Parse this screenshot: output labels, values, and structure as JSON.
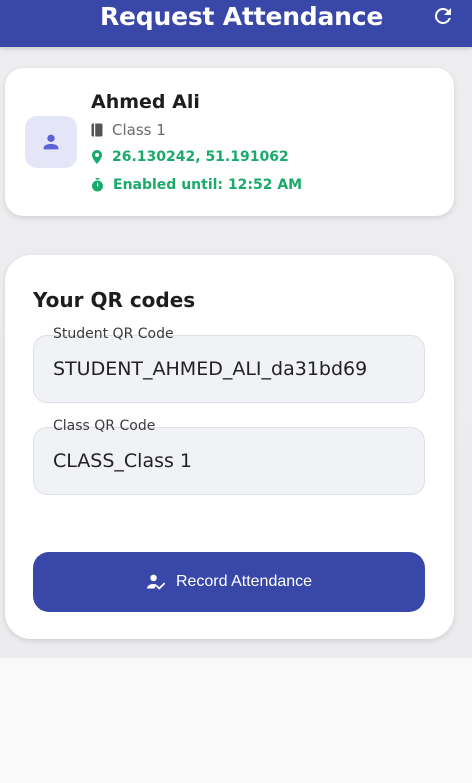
{
  "header": {
    "title": "Request Attendance"
  },
  "profile": {
    "name": "Ahmed Ali",
    "class": "Class 1",
    "location": "26.130242, 51.191062",
    "enabled_until": "Enabled until: 12:52 AM"
  },
  "qr_section": {
    "title": "Your QR codes",
    "student_field": {
      "label": "Student QR Code",
      "value": "STUDENT_AHMED_ALI_da31bd69"
    },
    "class_field": {
      "label": "Class QR Code",
      "value": "CLASS_Class 1"
    },
    "record_button": {
      "label": "Record Attendance"
    }
  },
  "colors": {
    "primary": "#3948a8",
    "success": "#1aaa6b",
    "avatar_bg": "#e4e6f8",
    "avatar_icon": "#5b63d6"
  },
  "icons": {
    "refresh": "refresh-icon",
    "avatar": "person-icon",
    "class": "book-icon",
    "location": "location-pin-icon",
    "timer": "timer-icon",
    "record": "person-check-icon"
  }
}
